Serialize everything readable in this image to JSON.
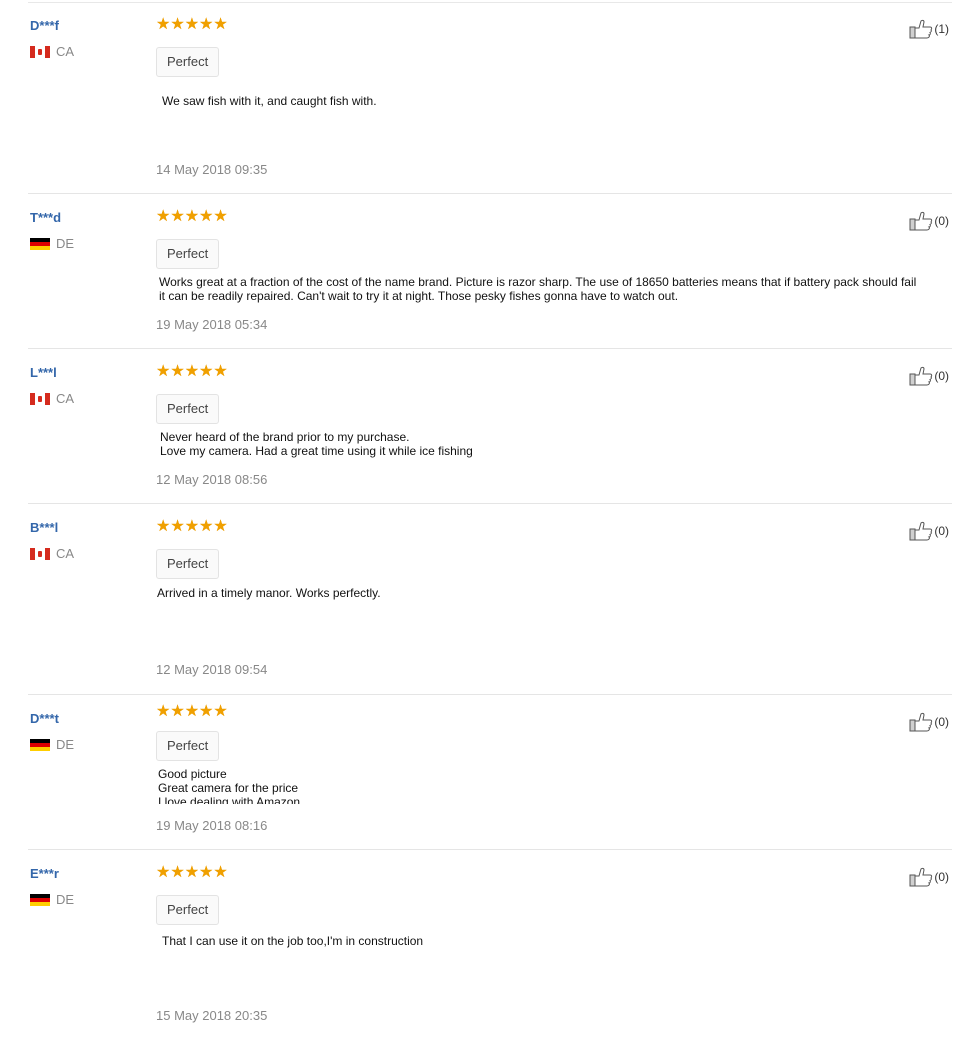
{
  "reviews": [
    {
      "user": "D***f",
      "country": "CA",
      "flag": "ca",
      "rating": 5,
      "rating_label": "Perfect",
      "text_lines": [
        "We saw fish with it, and caught fish with."
      ],
      "date": "14 May 2018 09:35",
      "helpful_count": "(1)"
    },
    {
      "user": "T***d",
      "country": "DE",
      "flag": "de",
      "rating": 5,
      "rating_label": "Perfect",
      "text_lines": [
        "Works great at a fraction of the cost of the name brand. Picture is razor sharp. The use of 18650 batteries means that if battery pack should fail",
        "it can be readily repaired. Can't wait to try it at night. Those pesky fishes gonna have to watch out."
      ],
      "date": "19 May 2018 05:34",
      "helpful_count": "(0)"
    },
    {
      "user": "L***l",
      "country": "CA",
      "flag": "ca",
      "rating": 5,
      "rating_label": "Perfect",
      "text_lines": [
        "Never heard of the brand prior to my purchase.",
        "Love my camera. Had a great time using it while ice fishing"
      ],
      "date": "12 May 2018 08:56",
      "helpful_count": "(0)"
    },
    {
      "user": "B***l",
      "country": "CA",
      "flag": "ca",
      "rating": 5,
      "rating_label": "Perfect",
      "text_lines": [
        "Arrived in a timely manor. Works perfectly."
      ],
      "date": "12 May 2018 09:54",
      "helpful_count": "(0)"
    },
    {
      "user": "D***t",
      "country": "DE",
      "flag": "de",
      "rating": 5,
      "rating_label": "Perfect",
      "text_lines": [
        "Good picture",
        "Great camera for the price",
        "I love dealing with Amazon"
      ],
      "date": "19 May 2018 08:16",
      "helpful_count": "(0)"
    },
    {
      "user": "E***r",
      "country": "DE",
      "flag": "de",
      "rating": 5,
      "rating_label": "Perfect",
      "text_lines": [
        "That I can use it on the job too,I'm in construction"
      ],
      "date": "15 May 2018 20:35",
      "helpful_count": "(0)"
    }
  ],
  "icons": {
    "star": "star-icon",
    "helpful": "thumbs-up-icon"
  },
  "colors": {
    "star": "#f0a000",
    "username": "#3366aa"
  }
}
